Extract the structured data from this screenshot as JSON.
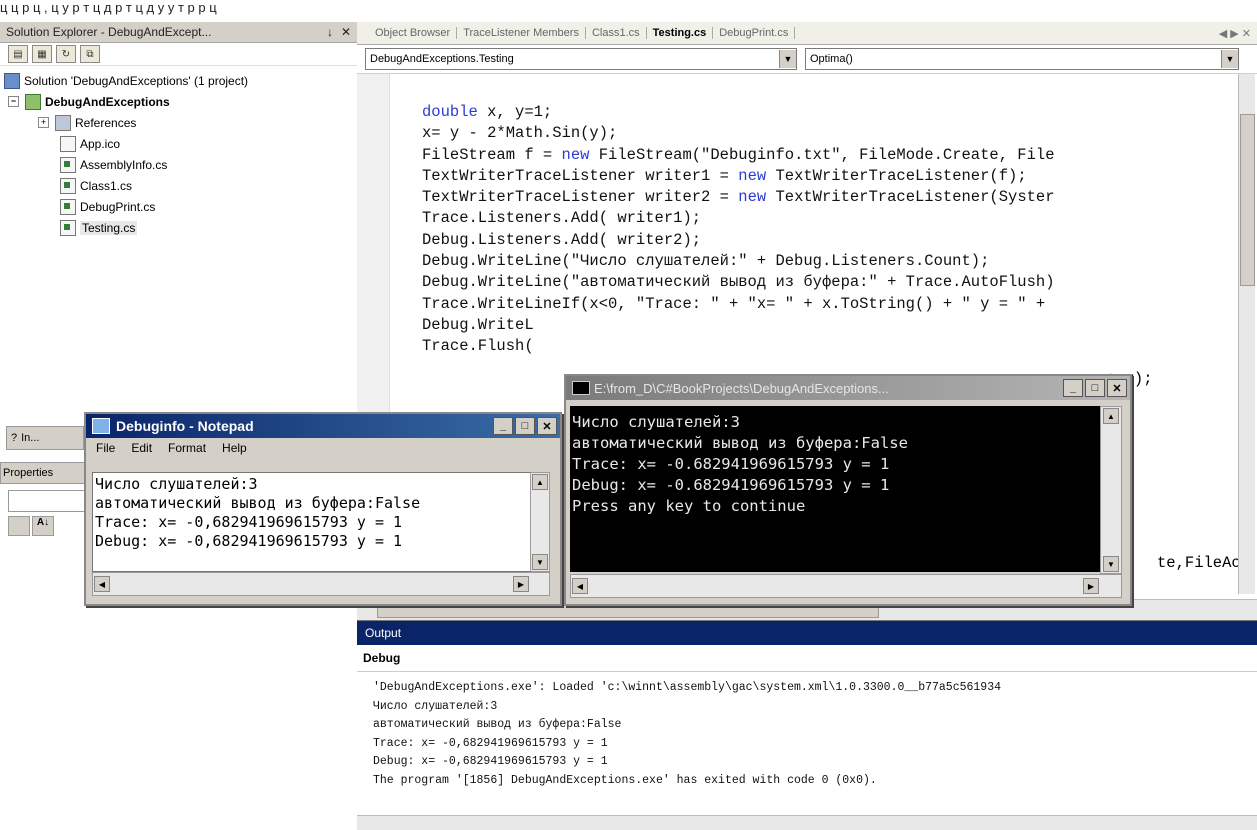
{
  "top_strip_text": "ц ц                  р ц ,  ц                 у р         т ц           д р  т  ц        д  у        у         т  р р ц ",
  "solution_explorer": {
    "title": "Solution Explorer - DebugAndExcept...",
    "pin": "↓",
    "close": "✕",
    "tree": {
      "solution": "Solution 'DebugAndExceptions' (1 project)",
      "project": "DebugAndExceptions",
      "items": [
        "References",
        "App.ico",
        "AssemblyInfo.cs",
        "Class1.cs",
        "DebugPrint.cs",
        "Testing.cs"
      ]
    }
  },
  "left_fragments": {
    "index_tab": "In...",
    "properties_label": "Properties"
  },
  "editor": {
    "tabs": [
      "Object Browser",
      "TraceListener Members",
      "Class1.cs",
      "Testing.cs",
      "DebugPrint.cs"
    ],
    "active_tab": "Testing.cs",
    "tab_nav": "◀ ▶ ✕",
    "class_combo": "DebugAndExceptions.Testing",
    "member_combo": "Optima()",
    "code_lines": [
      {
        "kw": "double",
        "rest": " x, y=1;"
      },
      {
        "kw": "",
        "rest": "x= y - 2*Math.Sin(y);"
      },
      {
        "pre": "FileStream f = ",
        "kw": "new",
        "rest": " FileStream(\"Debuginfo.txt\", FileMode.Create, File"
      },
      {
        "pre": "TextWriterTraceListener writer1 = ",
        "kw": "new",
        "rest": " TextWriterTraceListener(f);"
      },
      {
        "pre": "TextWriterTraceListener writer2 = ",
        "kw": "new",
        "rest": " TextWriterTraceListener(Syster"
      },
      {
        "kw": "",
        "rest": "Trace.Listeners.Add( writer1);"
      },
      {
        "kw": "",
        "rest": "Debug.Listeners.Add( writer2);"
      },
      {
        "kw": "",
        "rest": "Debug.WriteLine(\"Число слушателей:\" + Debug.Listeners.Count);"
      },
      {
        "kw": "",
        "rest": "Debug.WriteLine(\"автоматический вывод из буфера:\" + Trace.AutoFlush)"
      },
      {
        "kw": "",
        "rest": "Trace.WriteLineIf(x<0, \"Trace: \" + \"x= \" + x.ToString() + \" y = \" +"
      },
      {
        "kw": "",
        "rest": "Debug.WriteL"
      },
      {
        "kw": "",
        "rest": "Trace.Flush("
      }
    ],
    "code_frag_tail": "+ y);",
    "code_frag_right": "te,FileAc"
  },
  "output": {
    "title": "Output",
    "combo": "Debug",
    "lines": [
      "'DebugAndExceptions.exe': Loaded 'c:\\winnt\\assembly\\gac\\system.xml\\1.0.3300.0__b77a5c561934",
      "Число слушателей:3",
      "автоматический вывод из буфера:False",
      "Trace: x= -0,682941969615793 y = 1",
      "Debug: x= -0,682941969615793 y = 1",
      "The program '[1856] DebugAndExceptions.exe' has exited with code 0 (0x0)."
    ]
  },
  "notepad": {
    "title": "Debuginfo - Notepad",
    "menu": [
      "File",
      "Edit",
      "Format",
      "Help"
    ],
    "lines": [
      "Число слушателей:3",
      "автоматический вывод из буфера:False",
      "Trace: x= -0,682941969615793 y = 1",
      "Debug: x= -0,682941969615793 y = 1"
    ]
  },
  "console": {
    "title": "E:\\from_D\\C#BookProjects\\DebugAndExceptions...",
    "lines": [
      "Число слушателей:3",
      "автоматический вывод из буфера:False",
      "Trace: x= -0.682941969615793 y = 1",
      "Debug: x= -0.682941969615793 y = 1",
      "Press any key to continue"
    ]
  },
  "window_buttons": {
    "minimize": "_",
    "maximize": "□",
    "close": "✕"
  },
  "colors": {
    "title_active": "#0a246a",
    "keyword": "#2a3cd8",
    "console_bg": "#000000"
  }
}
